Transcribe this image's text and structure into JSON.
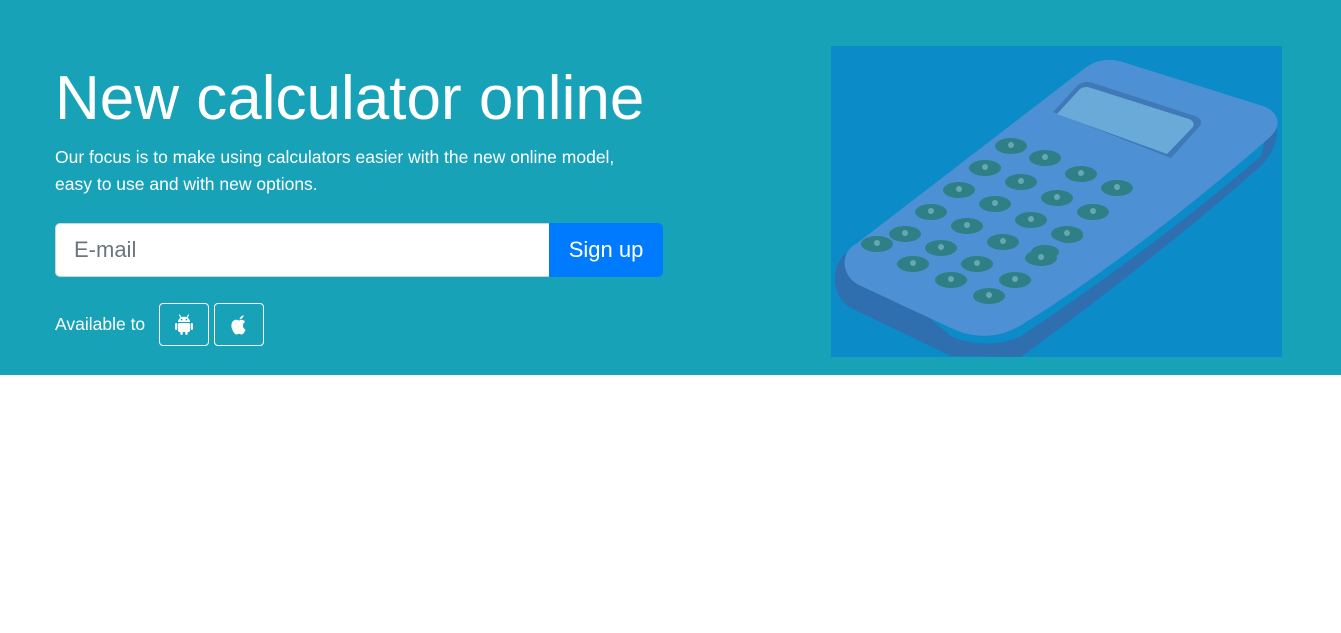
{
  "hero": {
    "title": "New calculator online",
    "lead": "Our focus is to make using calculators easier with the new online model, easy to use and with new options.",
    "colors": {
      "background": "#17a2b8",
      "button": "#007bff",
      "image_background": "#0b8bc8"
    }
  },
  "signup": {
    "email_placeholder": "E-mail",
    "email_value": "",
    "button_label": "Sign up"
  },
  "availability": {
    "label": "Available to",
    "platforms": [
      {
        "name": "Android",
        "icon": "android-icon"
      },
      {
        "name": "Apple",
        "icon": "apple-icon"
      }
    ]
  },
  "illustration": {
    "icon": "calculator-illustration"
  }
}
